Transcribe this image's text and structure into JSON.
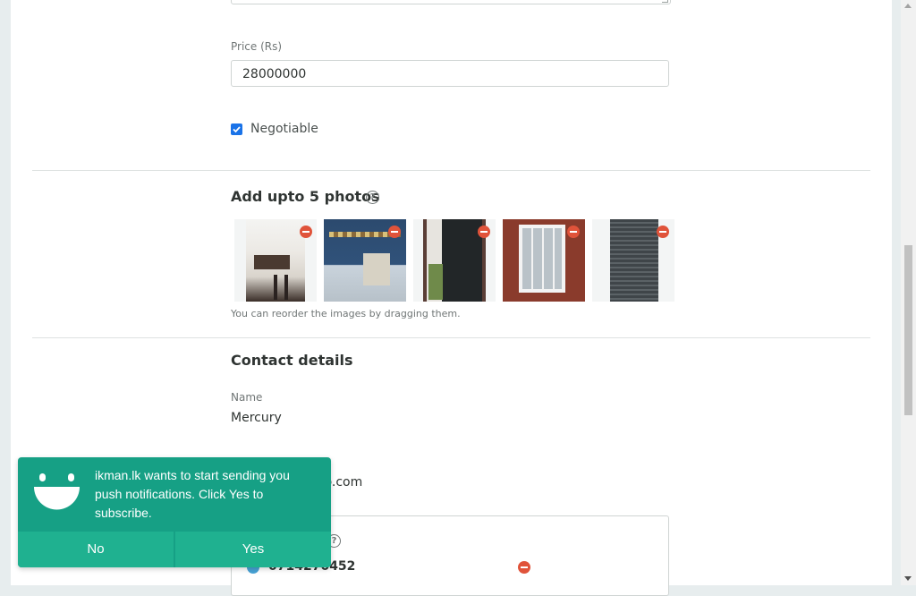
{
  "form": {
    "price_label": "Price (Rs)",
    "price_value": "28000000",
    "negotiable_label": "Negotiable",
    "negotiable_checked": true
  },
  "photos": {
    "title": "Add upto 5 photos",
    "help": "?",
    "hint": "You can reorder the images by dragging them.",
    "items": [
      "photo-1",
      "photo-2",
      "photo-3",
      "photo-4",
      "photo-5"
    ]
  },
  "contact": {
    "title": "Contact details",
    "name_label": "Name",
    "name_value": "Mercury",
    "email_partial": "oo.com",
    "phone_partial": "0714270452",
    "help": "?"
  },
  "notification": {
    "message": "ikman.lk wants to start sending you push notifications. Click Yes to subscribe.",
    "no_label": "No",
    "yes_label": "Yes"
  },
  "colors": {
    "accent": "#16a085",
    "checkbox": "#1a73e8",
    "remove": "#e0533a"
  }
}
